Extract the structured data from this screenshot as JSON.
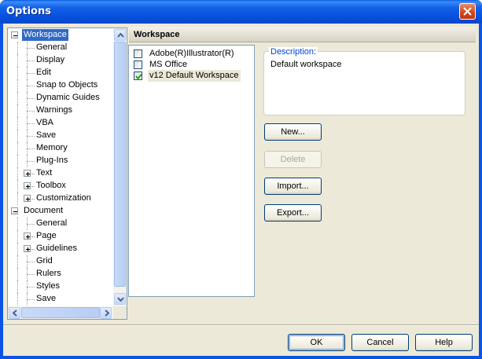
{
  "window": {
    "title": "Options"
  },
  "tree": {
    "items": [
      {
        "label": "Workspace",
        "level": 0,
        "expander": "minus",
        "selected": true
      },
      {
        "label": "General",
        "level": 1
      },
      {
        "label": "Display",
        "level": 1
      },
      {
        "label": "Edit",
        "level": 1
      },
      {
        "label": "Snap to Objects",
        "level": 1
      },
      {
        "label": "Dynamic Guides",
        "level": 1
      },
      {
        "label": "Warnings",
        "level": 1
      },
      {
        "label": "VBA",
        "level": 1
      },
      {
        "label": "Save",
        "level": 1
      },
      {
        "label": "Memory",
        "level": 1
      },
      {
        "label": "Plug-Ins",
        "level": 1
      },
      {
        "label": "Text",
        "level": 1,
        "expander": "plus"
      },
      {
        "label": "Toolbox",
        "level": 1,
        "expander": "plus"
      },
      {
        "label": "Customization",
        "level": 1,
        "expander": "plus"
      },
      {
        "label": "Document",
        "level": 0,
        "expander": "minus"
      },
      {
        "label": "General",
        "level": 1
      },
      {
        "label": "Page",
        "level": 1,
        "expander": "plus"
      },
      {
        "label": "Guidelines",
        "level": 1,
        "expander": "plus"
      },
      {
        "label": "Grid",
        "level": 1
      },
      {
        "label": "Rulers",
        "level": 1
      },
      {
        "label": "Styles",
        "level": 1
      },
      {
        "label": "Save",
        "level": 1
      }
    ]
  },
  "section": {
    "title": "Workspace"
  },
  "workspaces": [
    {
      "label": "Adobe(R)Illustrator(R)",
      "checked": false
    },
    {
      "label": "MS Office",
      "checked": false
    },
    {
      "label": "v12 Default Workspace",
      "checked": true,
      "selected": true
    }
  ],
  "description": {
    "legend": "Description:",
    "text": "Default workspace"
  },
  "buttons": {
    "new": "New...",
    "delete": "Delete",
    "import": "Import...",
    "export": "Export...",
    "ok": "OK",
    "cancel": "Cancel",
    "help": "Help"
  },
  "colors": {
    "titlebar": "#0a54e5",
    "selection": "#316ac5",
    "dialog": "#ece9d8"
  }
}
